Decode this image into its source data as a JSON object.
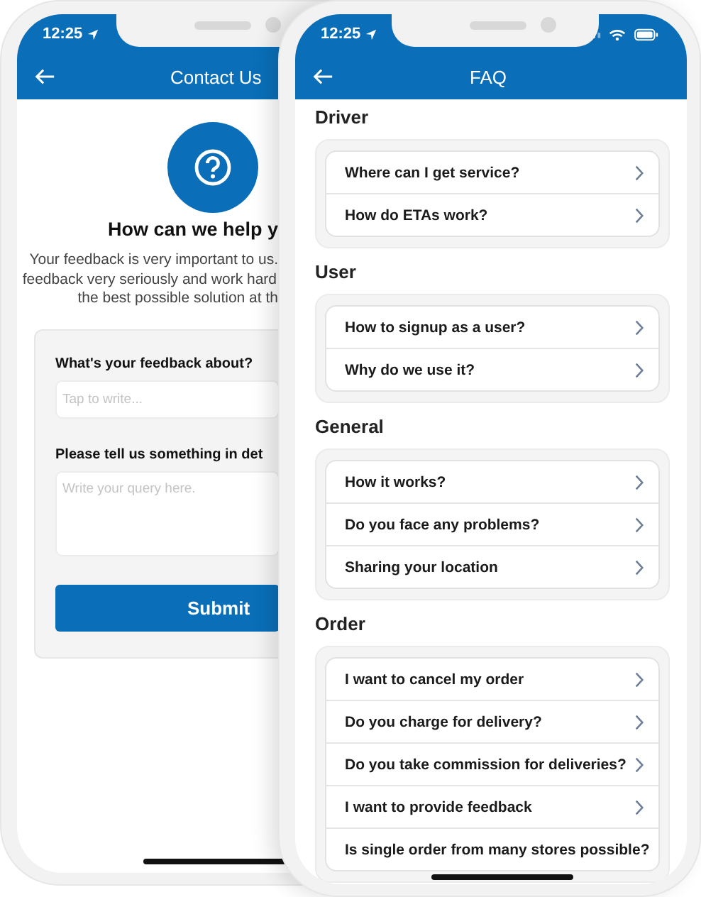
{
  "contact_screen": {
    "status_time": "12:25",
    "title": "Contact Us",
    "heading": "How can we help y",
    "help_text_lines": [
      "Your feedback is very important to us.",
      "feedback very seriously and work hard",
      "the best possible solution at th"
    ],
    "form": {
      "fields": [
        {
          "kind": "line",
          "label": "What's your feedback about?",
          "placeholder": "Tap to write..."
        },
        {
          "kind": "area",
          "label": "Please tell us something in det",
          "placeholder": "Write your query here."
        }
      ],
      "submit": "Submit"
    }
  },
  "faq_screen": {
    "status_time": "12:25",
    "title": "FAQ",
    "sections": [
      {
        "title": "Driver",
        "items": [
          "Where can I get service?",
          "How do ETAs work?"
        ]
      },
      {
        "title": "User",
        "items": [
          "How to signup as a user?",
          "Why do we use it?"
        ]
      },
      {
        "title": "General",
        "items": [
          "How it works?",
          "Do you face any problems?",
          "Sharing your location"
        ]
      },
      {
        "title": "Order",
        "items": [
          "I want to cancel my order",
          "Do you charge for delivery?",
          "Do you take commission for deliveries?",
          "I want to provide feedback",
          "Is single order from many stores possible?"
        ]
      }
    ]
  }
}
